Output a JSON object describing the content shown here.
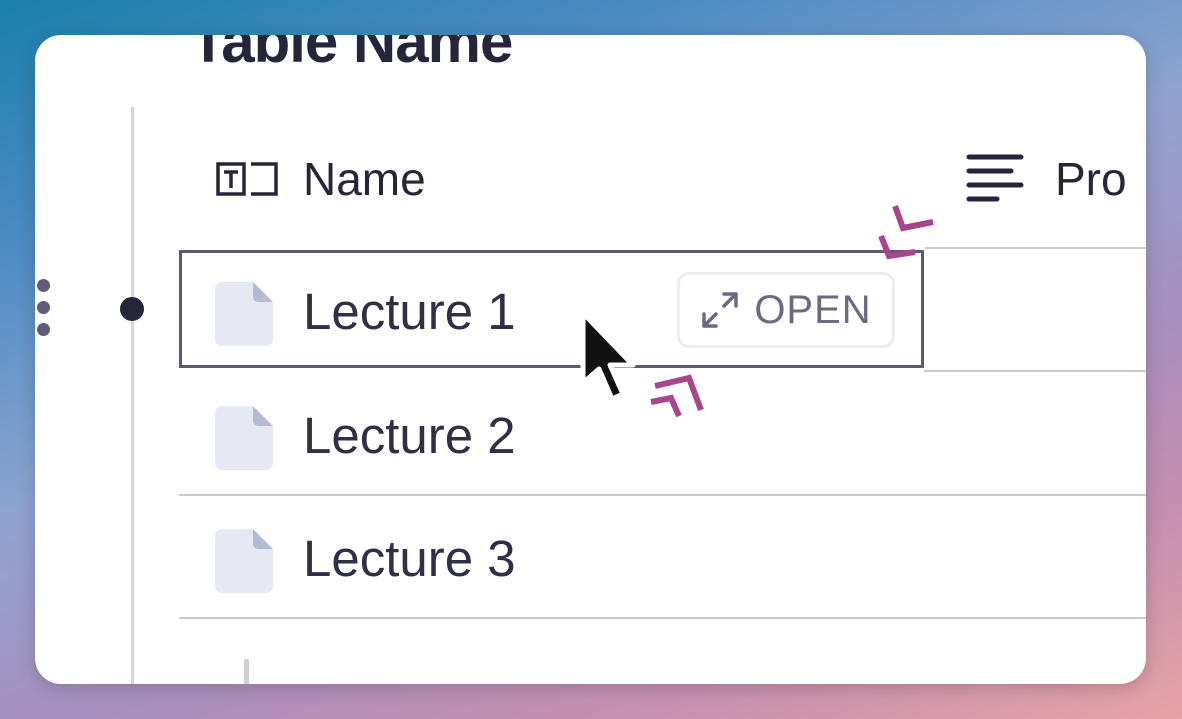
{
  "table": {
    "title": "Table Name",
    "columns": [
      {
        "label": "Name",
        "icon": "text-property-icon"
      },
      {
        "label": "Pro",
        "icon": "text-lines-icon"
      }
    ],
    "rows": [
      {
        "label": "Lecture 1",
        "icon": "document-icon",
        "selected": true
      },
      {
        "label": "Lecture 2",
        "icon": "document-icon"
      },
      {
        "label": "Lecture 3",
        "icon": "document-icon"
      }
    ],
    "open_button": {
      "label": "OPEN",
      "icon": "expand-arrows-icon"
    }
  },
  "colors": {
    "text": "#26263a",
    "selection_border": "#5a5a72",
    "highlight_accent": "#a9458f"
  }
}
